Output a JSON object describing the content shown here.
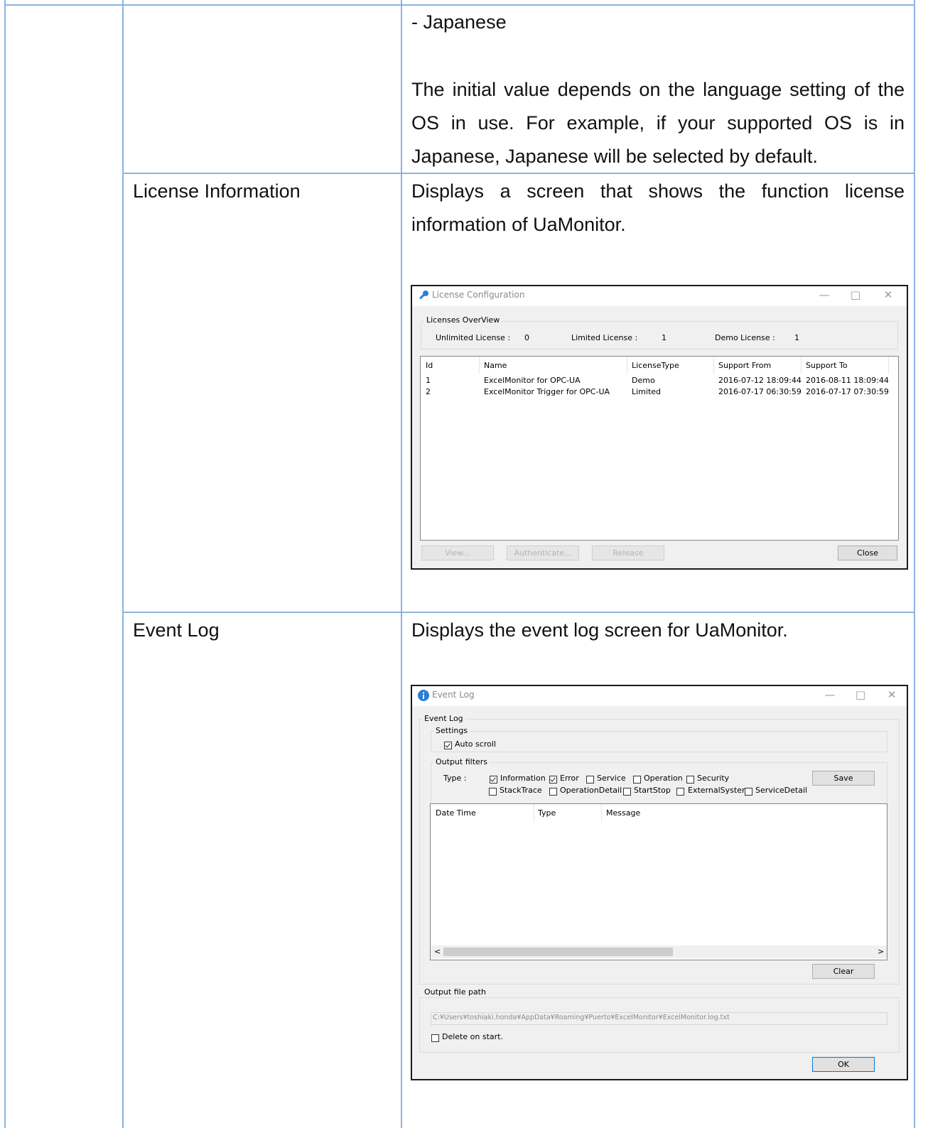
{
  "doc": {
    "row_language": {
      "bullet": "- Japanese",
      "note": "The initial value depends on the language setting of the OS in use. For example, if your supported OS is in Japanese, Japanese will be selected by default."
    },
    "row_license": {
      "item": "License Information",
      "description": "Displays a screen that shows the function license information of UaMonitor."
    },
    "row_eventlog": {
      "item": "Event Log",
      "description": "Displays the event log screen for UaMonitor."
    }
  },
  "license_window": {
    "title": "License Configuration",
    "overview": {
      "group_label": "Licenses OverView",
      "unlimited_label": "Unlimited License :",
      "unlimited_value": "0",
      "limited_label": "Limited License :",
      "limited_value": "1",
      "demo_label": "Demo License :",
      "demo_value": "1"
    },
    "columns": [
      "Id",
      "Name",
      "LicenseType",
      "Support From",
      "Support To"
    ],
    "rows": [
      [
        "1",
        "ExcelMonitor for OPC-UA",
        "Demo",
        "2016-07-12 18:09:44",
        "2016-08-11 18:09:44"
      ],
      [
        "2",
        "ExcelMonitor Trigger for OPC-UA",
        "Limited",
        "2016-07-17 06:30:59",
        "2016-07-17 07:30:59"
      ]
    ],
    "buttons": {
      "view": "View...",
      "authenticate": "Authenticate...",
      "release": "Release",
      "close": "Close"
    }
  },
  "event_window": {
    "title": "Event Log",
    "group_label": "Event Log",
    "settings_label": "Settings",
    "auto_scroll_label": "Auto scroll",
    "auto_scroll_checked": true,
    "filters_label": "Output filters",
    "type_label": "Type :",
    "filters": [
      {
        "label": "Information",
        "checked": true
      },
      {
        "label": "Error",
        "checked": true
      },
      {
        "label": "Service",
        "checked": false
      },
      {
        "label": "Operation",
        "checked": false
      },
      {
        "label": "Security",
        "checked": false
      },
      {
        "label": "StackTrace",
        "checked": false
      },
      {
        "label": "OperationDetail",
        "checked": false
      },
      {
        "label": "StartStop",
        "checked": false
      },
      {
        "label": "ExternalSystem",
        "checked": false
      },
      {
        "label": "ServiceDetail",
        "checked": false
      }
    ],
    "save_label": "Save",
    "columns": [
      "Date Time",
      "Type",
      "Message"
    ],
    "clear_label": "Clear",
    "path_group_label": "Output file path",
    "path_value": "C:¥Users¥toshiaki.honda¥AppData¥Roaming¥Puerto¥ExcelMonitor¥ExcelMonitor.log.txt",
    "delete_on_start_label": "Delete on start.",
    "delete_on_start_checked": false,
    "ok_label": "OK"
  }
}
